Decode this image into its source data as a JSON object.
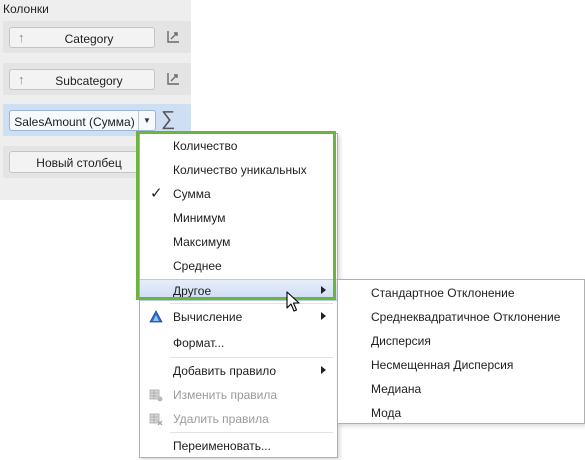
{
  "panel": {
    "title": "Колонки",
    "fields": [
      {
        "label": "Category",
        "sort_icon": "sort-up-arrow-icon",
        "action_icon": "axis-transform-icon"
      },
      {
        "label": "Subcategory",
        "sort_icon": "sort-up-arrow-icon",
        "action_icon": "axis-transform-icon"
      }
    ],
    "active_field": {
      "label": "SalesAmount (Сумма)",
      "dropdown_icon": "dropdown-arrow-icon",
      "action_icon": "sigma-icon",
      "sigma_glyph": "∑"
    },
    "new_column_label": "Новый столбец"
  },
  "menu": {
    "items": [
      {
        "label": "Количество",
        "checked": false
      },
      {
        "label": "Количество уникальных",
        "checked": false
      },
      {
        "label": "Сумма",
        "checked": true
      },
      {
        "label": "Минимум",
        "checked": false
      },
      {
        "label": "Максимум",
        "checked": false
      },
      {
        "label": "Среднее",
        "checked": false
      },
      {
        "label": "Другое",
        "submenu": true,
        "selected": true
      },
      {
        "label": "Вычисление",
        "submenu": true,
        "icon": "calculation-triangle-icon"
      },
      {
        "label": "Формат..."
      },
      {
        "label": "Добавить правило",
        "submenu": true
      },
      {
        "label": "Изменить правила",
        "disabled": true,
        "icon": "edit-rules-icon"
      },
      {
        "label": "Удалить правила",
        "disabled": true,
        "icon": "delete-rules-icon"
      },
      {
        "label": "Переименовать..."
      }
    ]
  },
  "submenu": {
    "items": [
      {
        "label": "Стандартное Отклонение"
      },
      {
        "label": "Среднеквадратичное Отклонение"
      },
      {
        "label": "Дисперсия"
      },
      {
        "label": "Несмещенная Дисперсия"
      },
      {
        "label": "Медиана"
      },
      {
        "label": "Мода"
      }
    ]
  },
  "colors": {
    "highlight_border": "#6cb33f",
    "selected_item": "#cddcf3",
    "active_row": "#cfdff3",
    "calc_icon": "#2a6fc9"
  },
  "check_glyph": "✓",
  "up_arrow_glyph": "↑",
  "dropdown_glyph": "▼"
}
